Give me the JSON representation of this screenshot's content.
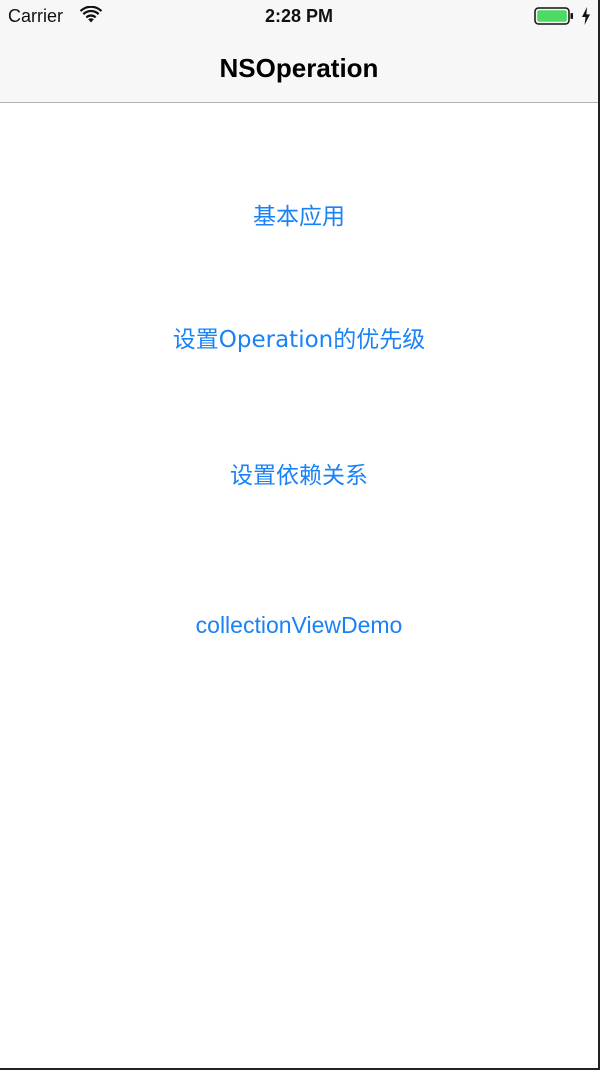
{
  "status_bar": {
    "carrier": "Carrier",
    "time": "2:28 PM",
    "wifi_icon": "wifi-icon",
    "battery_icon": "battery-icon",
    "charging_icon": "charging-bolt-icon",
    "battery_color": "#4cd964"
  },
  "nav_bar": {
    "title": "NSOperation"
  },
  "menu": {
    "accent_color": "#1a82f7",
    "items": [
      {
        "label": "基本应用"
      },
      {
        "label": "设置Operation的优先级"
      },
      {
        "label": "设置依赖关系"
      },
      {
        "label": "collectionViewDemo"
      }
    ]
  }
}
